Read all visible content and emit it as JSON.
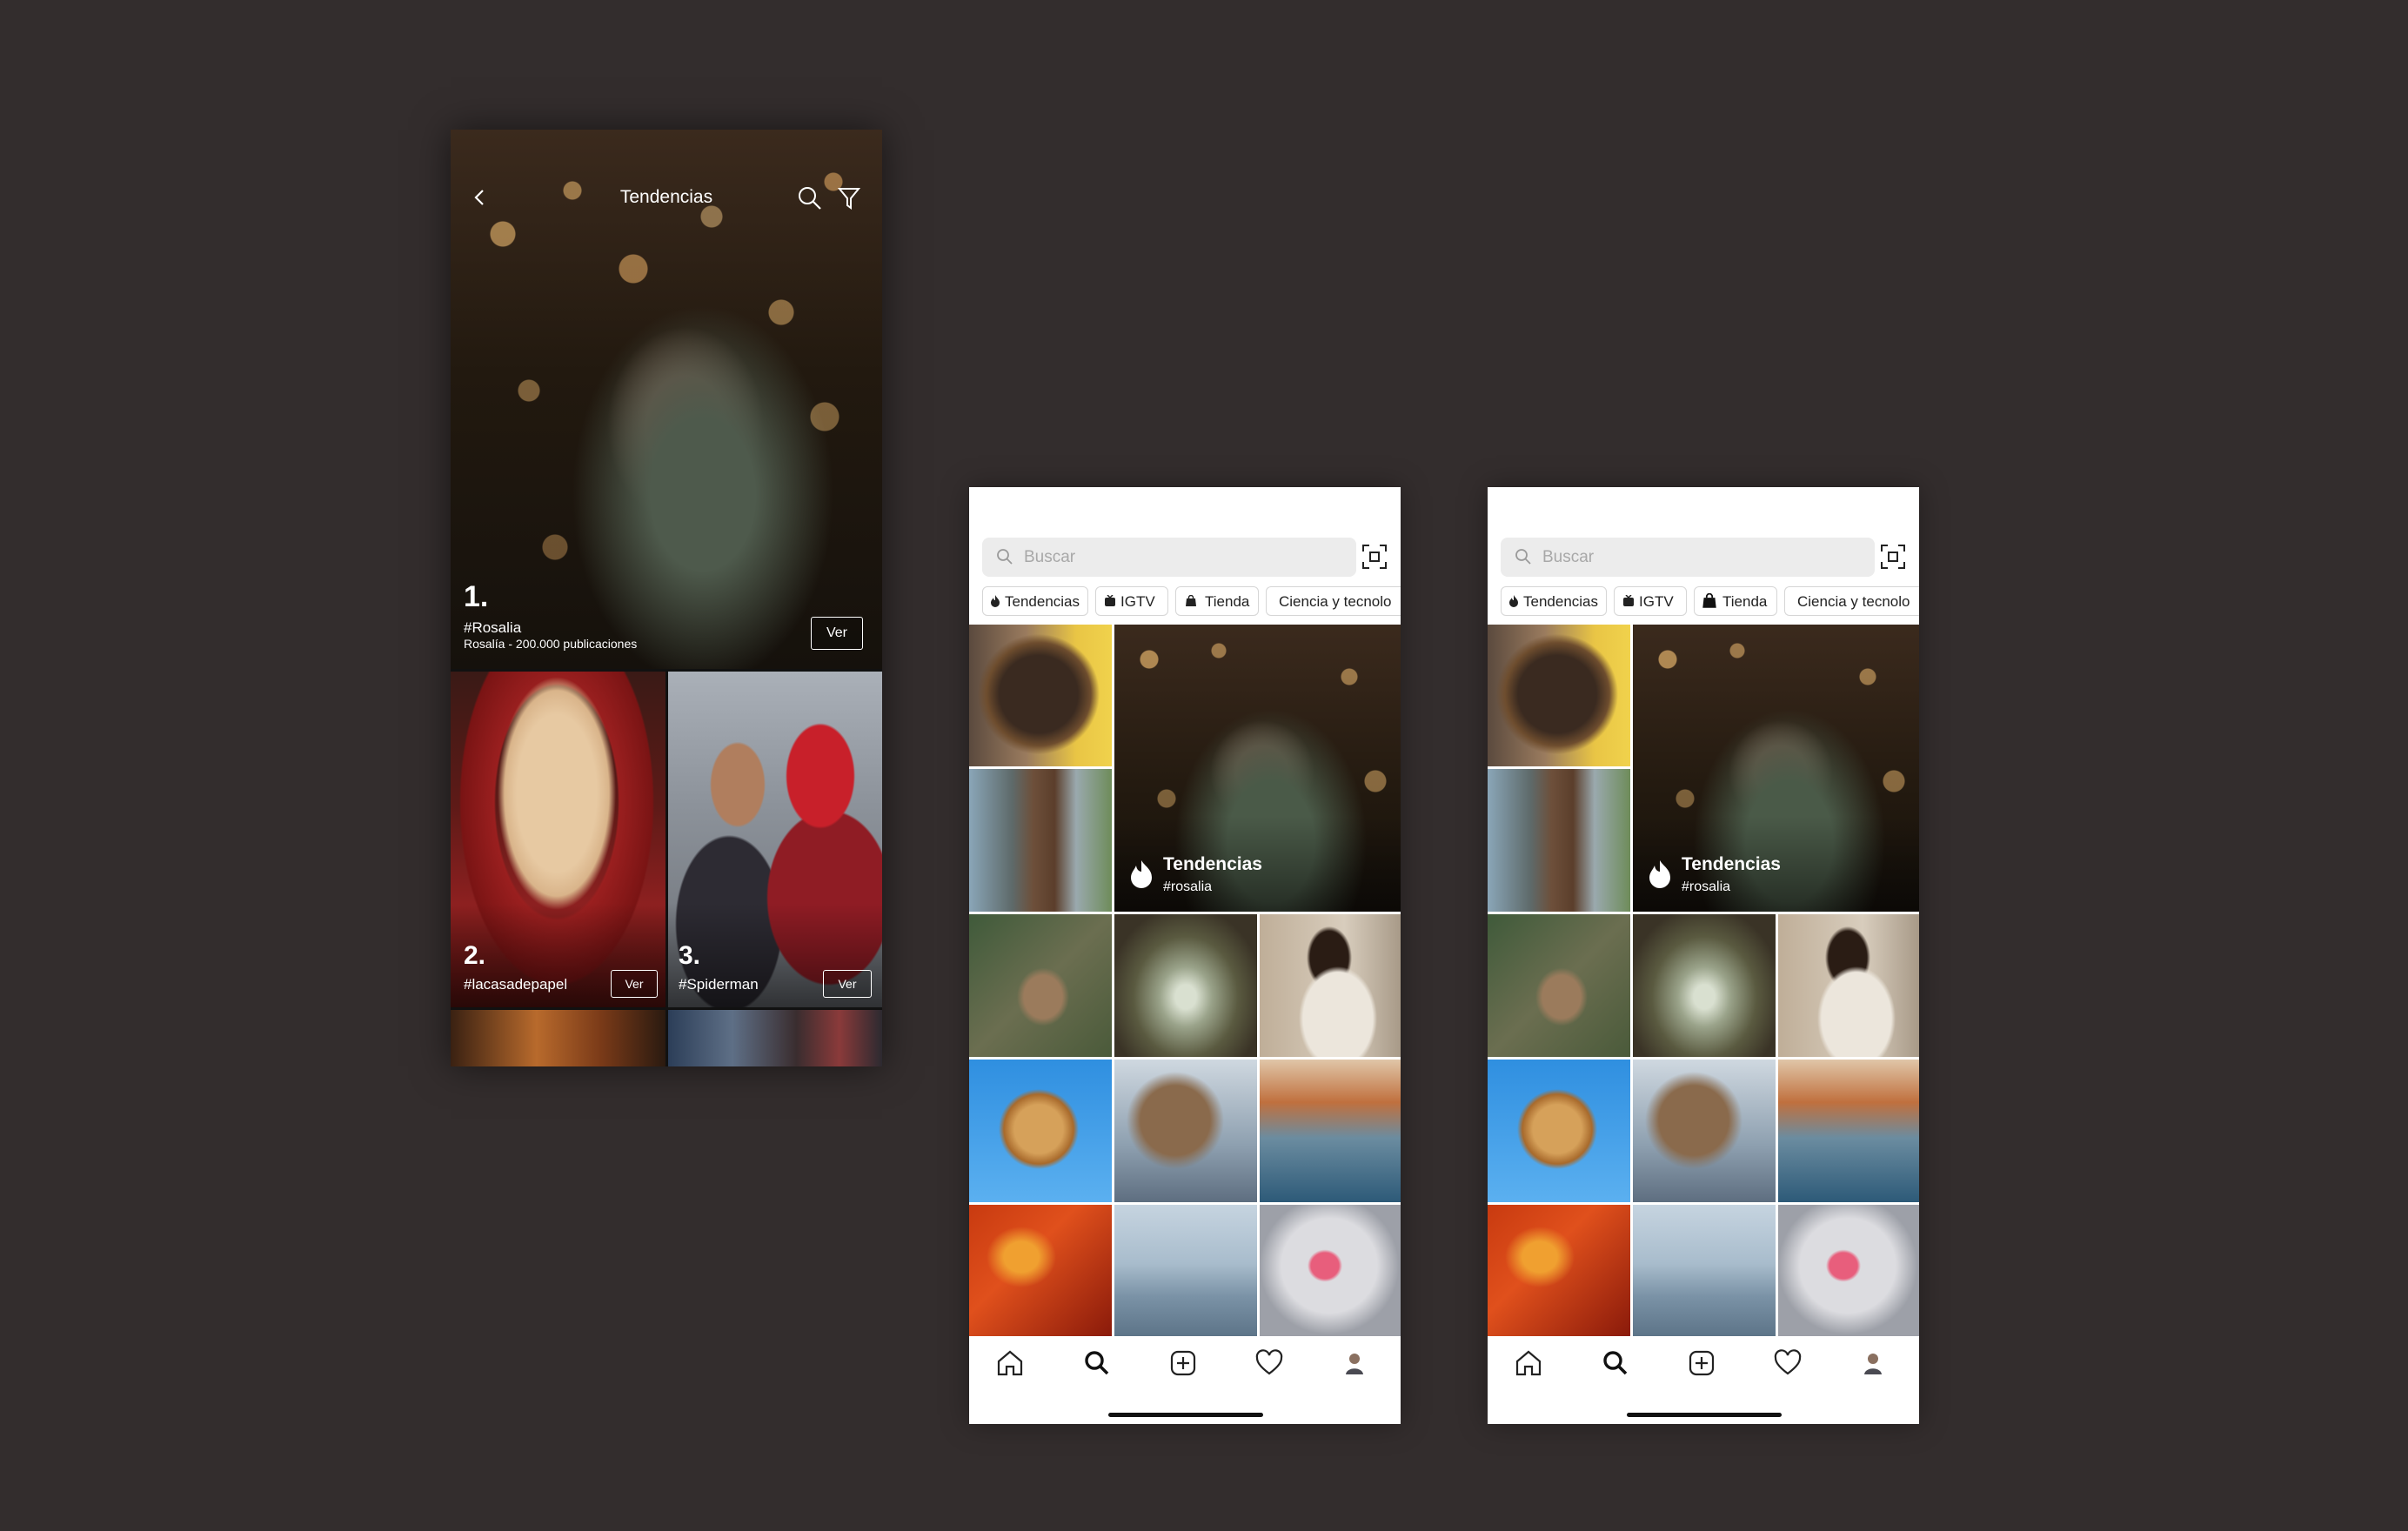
{
  "trends": {
    "title": "Tendencias",
    "items": [
      {
        "rank": "1.",
        "tag": "#Rosalia",
        "subtitle": "Rosalía - 200.000 publicaciones",
        "button": "Ver"
      },
      {
        "rank": "2.",
        "tag": "#lacasadepapel",
        "button": "Ver"
      },
      {
        "rank": "3.",
        "tag": "#Spiderman",
        "button": "Ver"
      }
    ]
  },
  "explore": {
    "search_placeholder": "Buscar",
    "chips": [
      "Tendencias",
      "IGTV",
      "Tienda",
      "Ciencia y tecnolo"
    ],
    "featured": {
      "title": "Tendencias",
      "tag": "#rosalia"
    }
  },
  "colors": {
    "background": "#332d2d",
    "text_on_image": "#ffffff",
    "chip_border": "#d6d6d6"
  }
}
